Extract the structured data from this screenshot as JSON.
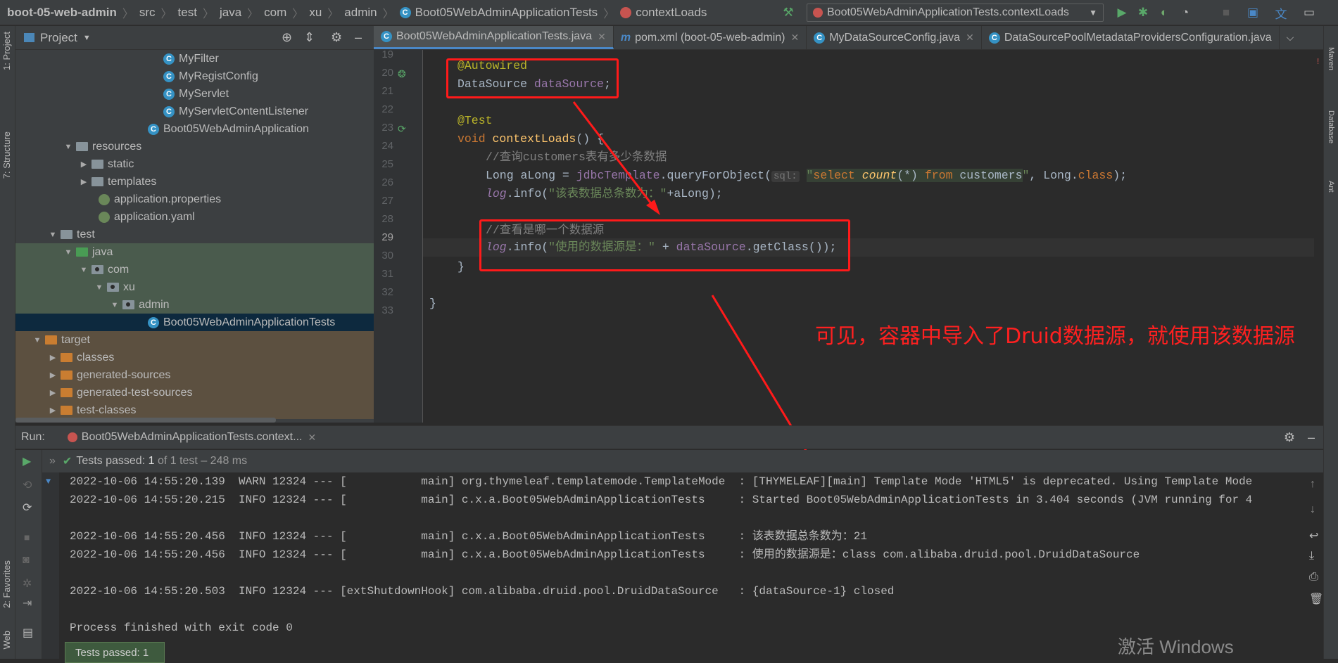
{
  "navbar": {
    "crumbs": [
      "boot-05-web-admin",
      "src",
      "test",
      "java",
      "com",
      "xu",
      "admin",
      "Boot05WebAdminApplicationTests",
      "contextLoads"
    ],
    "run_config": "Boot05WebAdminApplicationTests.contextLoads"
  },
  "left_strip": {
    "project_tab": "1: Project",
    "structure_tab": "7: Structure",
    "favorites_tab": "2: Favorites",
    "web_tab": "Web"
  },
  "project": {
    "title": "Project",
    "tree": [
      {
        "label": "MyFilter",
        "kind": "class"
      },
      {
        "label": "MyRegistConfig",
        "kind": "class"
      },
      {
        "label": "MyServlet",
        "kind": "class"
      },
      {
        "label": "MyServletContentListener",
        "kind": "class"
      },
      {
        "label": "Boot05WebAdminApplication",
        "kind": "class"
      },
      {
        "label": "resources",
        "kind": "folder"
      },
      {
        "label": "static",
        "kind": "folder"
      },
      {
        "label": "templates",
        "kind": "folder"
      },
      {
        "label": "application.properties",
        "kind": "leaf"
      },
      {
        "label": "application.yaml",
        "kind": "leaf"
      },
      {
        "label": "test",
        "kind": "folder"
      },
      {
        "label": "java",
        "kind": "folder"
      },
      {
        "label": "com",
        "kind": "folder"
      },
      {
        "label": "xu",
        "kind": "folder"
      },
      {
        "label": "admin",
        "kind": "folder"
      },
      {
        "label": "Boot05WebAdminApplicationTests",
        "kind": "class"
      },
      {
        "label": "target",
        "kind": "folder"
      },
      {
        "label": "classes",
        "kind": "folder"
      },
      {
        "label": "generated-sources",
        "kind": "folder"
      },
      {
        "label": "generated-test-sources",
        "kind": "folder"
      },
      {
        "label": "test-classes",
        "kind": "folder"
      }
    ]
  },
  "tabs": [
    {
      "label": "Boot05WebAdminApplicationTests.java",
      "active": true
    },
    {
      "label": "pom.xml (boot-05-web-admin)",
      "active": false
    },
    {
      "label": "MyDataSourceConfig.java",
      "active": false
    },
    {
      "label": "DataSourcePoolMetadataProvidersConfiguration.java",
      "active": false
    }
  ],
  "editor": {
    "line_numbers": [
      "19",
      "20",
      "21",
      "22",
      "23",
      "24",
      "25",
      "26",
      "27",
      "28",
      "29",
      "30",
      "31",
      "32",
      "33"
    ],
    "lines": {
      "l19": "@Autowired",
      "l20a": "DataSource ",
      "l20b": "dataSource",
      "l20c": ";",
      "l22": "@Test",
      "l23a": "void ",
      "l23b": "contextLoads",
      "l23c": "() {",
      "l24": "//查询customers表有多少条数据",
      "l25a": "Long aLong = ",
      "l25b": "jdbcTemplate",
      "l25c": ".queryForObject(",
      "l25hint": "sql:",
      "l25d": "\"",
      "l25e": "select ",
      "l25f": "count",
      "l25g": "(*) ",
      "l25h": "from ",
      "l25i": "customers",
      "l25j": "\"",
      "l25k": ", Long.",
      "l25l": "class",
      "l25m": ");",
      "l26a": "log",
      "l26b": ".info(",
      "l26c": "\"该表数据总条数为：\"",
      "l26d": "+aLong);",
      "l28": "//查看是哪一个数据源",
      "l29a": "log",
      "l29b": ".info(",
      "l29c": "\"使用的数据源是：\"",
      "l29d": " + ",
      "l29e": "dataSource",
      "l29f": ".getClass());",
      "l30": "}",
      "l32": "}"
    }
  },
  "annotation_note": "可见，容器中导入了Druid数据源，就使用该数据源",
  "run": {
    "label": "Run:",
    "tab": "Boot05WebAdminApplicationTests.context...",
    "status_prefix": "Tests passed:",
    "status_count": "1",
    "status_suffix": "of 1 test – 248 ms",
    "console": [
      "2022-10-06 14:55:20.139  WARN 12324 --- [           main] org.thymeleaf.templatemode.TemplateMode  : [THYMELEAF][main] Template Mode 'HTML5' is deprecated. Using Template Mode",
      "2022-10-06 14:55:20.215  INFO 12324 --- [           main] c.x.a.Boot05WebAdminApplicationTests     : Started Boot05WebAdminApplicationTests in 3.404 seconds (JVM running for 4",
      "",
      "2022-10-06 14:55:20.456  INFO 12324 --- [           main] c.x.a.Boot05WebAdminApplicationTests     : 该表数据总条数为：21",
      "2022-10-06 14:55:20.456  INFO 12324 --- [           main] c.x.a.Boot05WebAdminApplicationTests     : 使用的数据源是：class com.alibaba.druid.pool.DruidDataSource",
      "",
      "2022-10-06 14:55:20.503  INFO 12324 --- [extShutdownHook] com.alibaba.druid.pool.DruidDataSource   : {dataSource-1} closed",
      "",
      "Process finished with exit code 0"
    ],
    "badge": "Tests passed: 1"
  },
  "watermark": "激活 Windows",
  "colors": {
    "accent": "#4a88c7",
    "annotation_red": "#ff1a1a"
  }
}
